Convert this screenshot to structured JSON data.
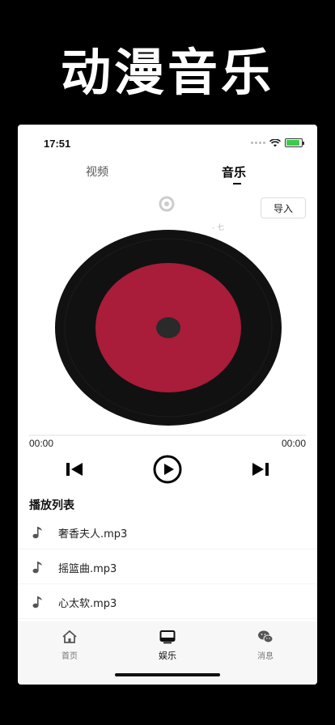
{
  "promo": {
    "title": "动漫音乐"
  },
  "status": {
    "time": "17:51",
    "battery_level": 0.9
  },
  "tabs": [
    {
      "label": "视频",
      "active": false
    },
    {
      "label": "音乐",
      "active": true
    }
  ],
  "import_label": "导入",
  "faded_text": "- 七",
  "record_colors": {
    "vinyl": "#111111",
    "label": "#a91c3a",
    "spindle": "#2a2a2a"
  },
  "player": {
    "current_time": "00:00",
    "total_time": "00:00",
    "progress": 0
  },
  "controls": {
    "prev_icon": "skip-previous-icon",
    "play_icon": "play-circle-icon",
    "next_icon": "skip-next-icon"
  },
  "playlist": {
    "heading": "播放列表",
    "tracks": [
      {
        "name": "奢香夫人.mp3",
        "icon": "music-note-icon"
      },
      {
        "name": "摇篮曲.mp3",
        "icon": "music-note-icon"
      },
      {
        "name": "心太软.mp3",
        "icon": "music-note-icon"
      }
    ]
  },
  "bottom_nav": [
    {
      "label": "首页",
      "icon": "home-icon",
      "active": false
    },
    {
      "label": "娱乐",
      "icon": "tv-icon",
      "active": true
    },
    {
      "label": "消息",
      "icon": "wechat-icon",
      "active": false
    }
  ]
}
